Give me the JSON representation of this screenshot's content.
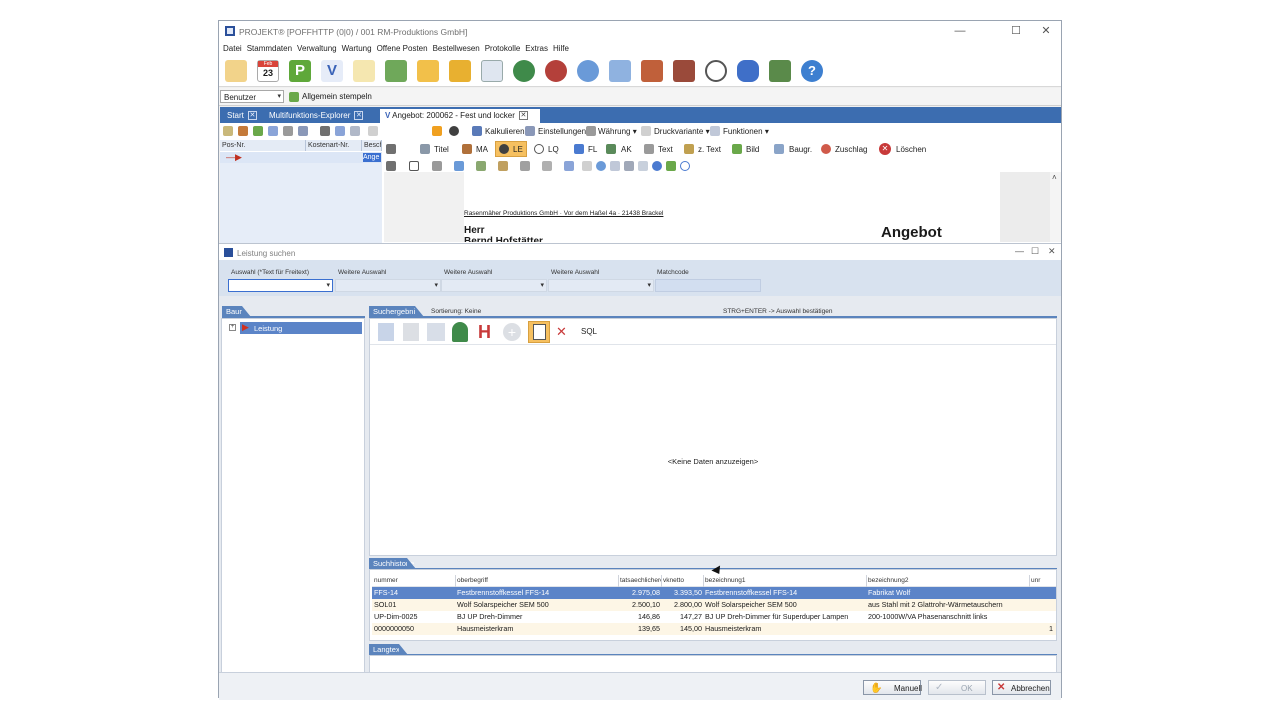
{
  "window": {
    "title": "PROJEKT® [POFFHTTP (0|0) / 001 RM-Produktions GmbH]",
    "minimize": "—",
    "maximize": "☐",
    "close": "✕"
  },
  "menu": [
    "Datei",
    "Stammdaten",
    "Verwaltung",
    "Wartung",
    "Offene Posten",
    "Bestellwesen",
    "Protokolle",
    "Extras",
    "Hilfe"
  ],
  "toolbar": {
    "calendar_day": "23",
    "calendar_month": "Feb"
  },
  "userbar": {
    "user_select": "Benutzer",
    "stamp_button": "Allgemein stempeln"
  },
  "tabs": [
    {
      "label": "Start"
    },
    {
      "label": "Multifunktions-Explorer"
    },
    {
      "label": "Angebot: 200062 - Fest und locker"
    }
  ],
  "angebot": {
    "ribbon1": {
      "kalkulieren": "Kalkulieren",
      "einstellungen": "Einstellungen",
      "waehrung": "Währung",
      "druckvariante": "Druckvariante",
      "funktionen": "Funktionen"
    },
    "ribbon2": {
      "titel": "Titel",
      "ma": "MA",
      "le": "LE",
      "lq": "LQ",
      "fl": "FL",
      "ak": "AK",
      "text": "Text",
      "ztext": "z. Text",
      "bild": "Bild",
      "baugr": "Baugr.",
      "zuschlag": "Zuschlag",
      "loeschen": "Löschen"
    },
    "grid_headers": [
      "Pos-Nr.",
      "Kostenart-Nr.",
      "Besch"
    ],
    "grid_row_cell": "Ange",
    "doc": {
      "sender_line": "Rasenmäher Produktions GmbH · Vor dem Haßel 4a · 21438 Brackel",
      "salutation": "Herr",
      "name": "Bernd Hofstätter",
      "heading": "Angebot"
    }
  },
  "dialog": {
    "title": "Leistung suchen",
    "fields": {
      "auswahl_label": "Auswahl (*Text für Freitext)",
      "weitere1_label": "Weitere Auswahl",
      "weitere2_label": "Weitere Auswahl",
      "weitere3_label": "Weitere Auswahl",
      "matchcode_label": "Matchcode"
    },
    "baum": {
      "header": "Baum",
      "root": "Leistung"
    },
    "result": {
      "header": "Suchergebnis",
      "sort": "Sortierung: Keine",
      "hint": "STRG+ENTER -> Auswahl bestätigen",
      "sql": "SQL",
      "empty": "<Keine Daten anzuzeigen>"
    },
    "history": {
      "header": "Suchhistorie",
      "columns": [
        "nummer",
        "oberbegriff",
        "tatsaechlichere",
        "vknetto",
        "bezeichnung1",
        "bezeichnung2",
        "unr"
      ],
      "rows": [
        [
          "FFS-14",
          "Festbrennstoffkessel FFS-14",
          "2.975,08",
          "3.393,50",
          "Festbrennstoffkessel FFS-14",
          "Fabrikat Wolf",
          ""
        ],
        [
          "SOL01",
          "Wolf Solarspeicher SEM 500",
          "2.500,10",
          "2.800,00",
          "Wolf Solarspeicher SEM 500",
          "aus Stahl mit 2 Glattrohr-Wärmetauschern",
          ""
        ],
        [
          "UP-Dim-0025",
          "BJ UP Dreh-Dimmer",
          "146,86",
          "147,27",
          "BJ UP Dreh-Dimmer für Superduper Lampen",
          "200-1000W/VA Phasenanschnitt links",
          ""
        ],
        [
          "0000000050",
          "Hausmeisterkram",
          "139,65",
          "145,00",
          "Hausmeisterkram",
          "",
          "1"
        ]
      ]
    },
    "langtext": {
      "header": "Langtext"
    },
    "buttons": {
      "manuell": "Manuell",
      "ok": "OK",
      "abbrechen": "Abbrechen"
    }
  },
  "colors": {
    "tabstrip": "#3c6db0",
    "section_header": "#5b84bd",
    "selected_row": "#5b84c8"
  }
}
